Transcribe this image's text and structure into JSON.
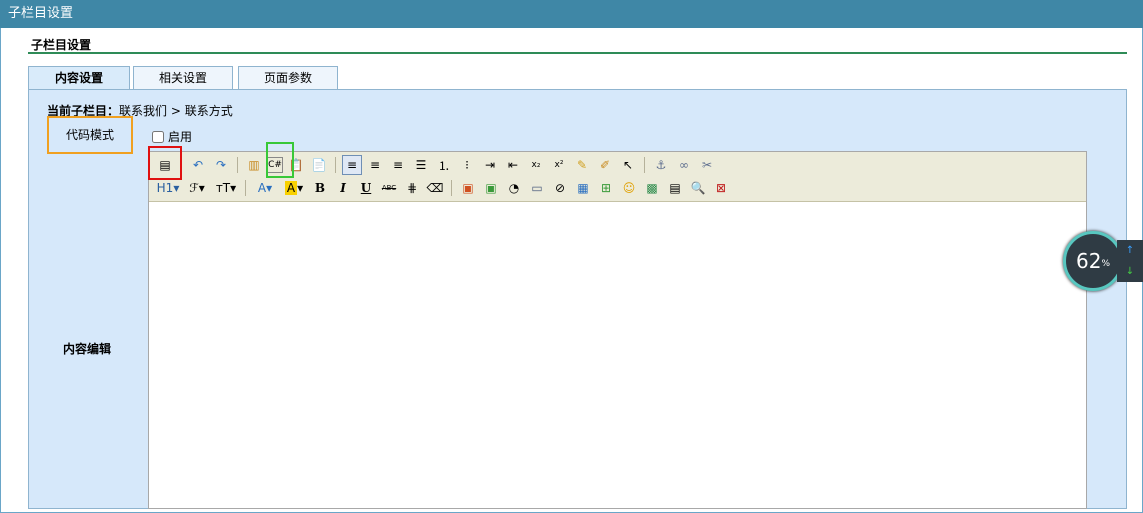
{
  "window": {
    "title": "子栏目设置"
  },
  "section": {
    "title": "子栏目设置"
  },
  "tabs": [
    {
      "label": "内容设置",
      "active": true
    },
    {
      "label": "相关设置",
      "active": false
    },
    {
      "label": "页面参数",
      "active": false
    }
  ],
  "breadcrumb": {
    "prefix": "当前子栏目：",
    "path": "联系我们 > 联系方式"
  },
  "code_mode": {
    "label": "代码模式",
    "checkbox_label": "启用",
    "checked": false
  },
  "content_edit": {
    "label": "内容编辑"
  },
  "toolbar": {
    "row1": [
      "source-icon",
      "undo-icon",
      "redo-icon",
      "template-icon",
      "code-csharp-icon",
      "paste-text-icon",
      "paste-word-icon",
      "align-left-icon",
      "align-center-icon",
      "align-right-icon",
      "align-justify-icon",
      "ordered-list-icon",
      "unordered-list-icon",
      "indent-icon",
      "outdent-icon",
      "subscript-icon",
      "superscript-icon",
      "clear-format-icon",
      "select-all-icon",
      "cursor-icon",
      "anchor-icon",
      "link-icon",
      "unlink-icon"
    ],
    "row2_text": {
      "heading": "H1",
      "font": "ℱ",
      "size": "тT",
      "font_color": "A",
      "bg_color": "A",
      "bold": "B",
      "italic": "I",
      "underline": "U",
      "strike": "ABC"
    }
  },
  "progress": {
    "value": "62",
    "unit": "%"
  },
  "colors": {
    "titlebar": "#3f87a6",
    "panel": "#d6e8fa",
    "highlight_red": "#e01010",
    "highlight_green": "#38c838",
    "highlight_orange": "#f0a020"
  }
}
